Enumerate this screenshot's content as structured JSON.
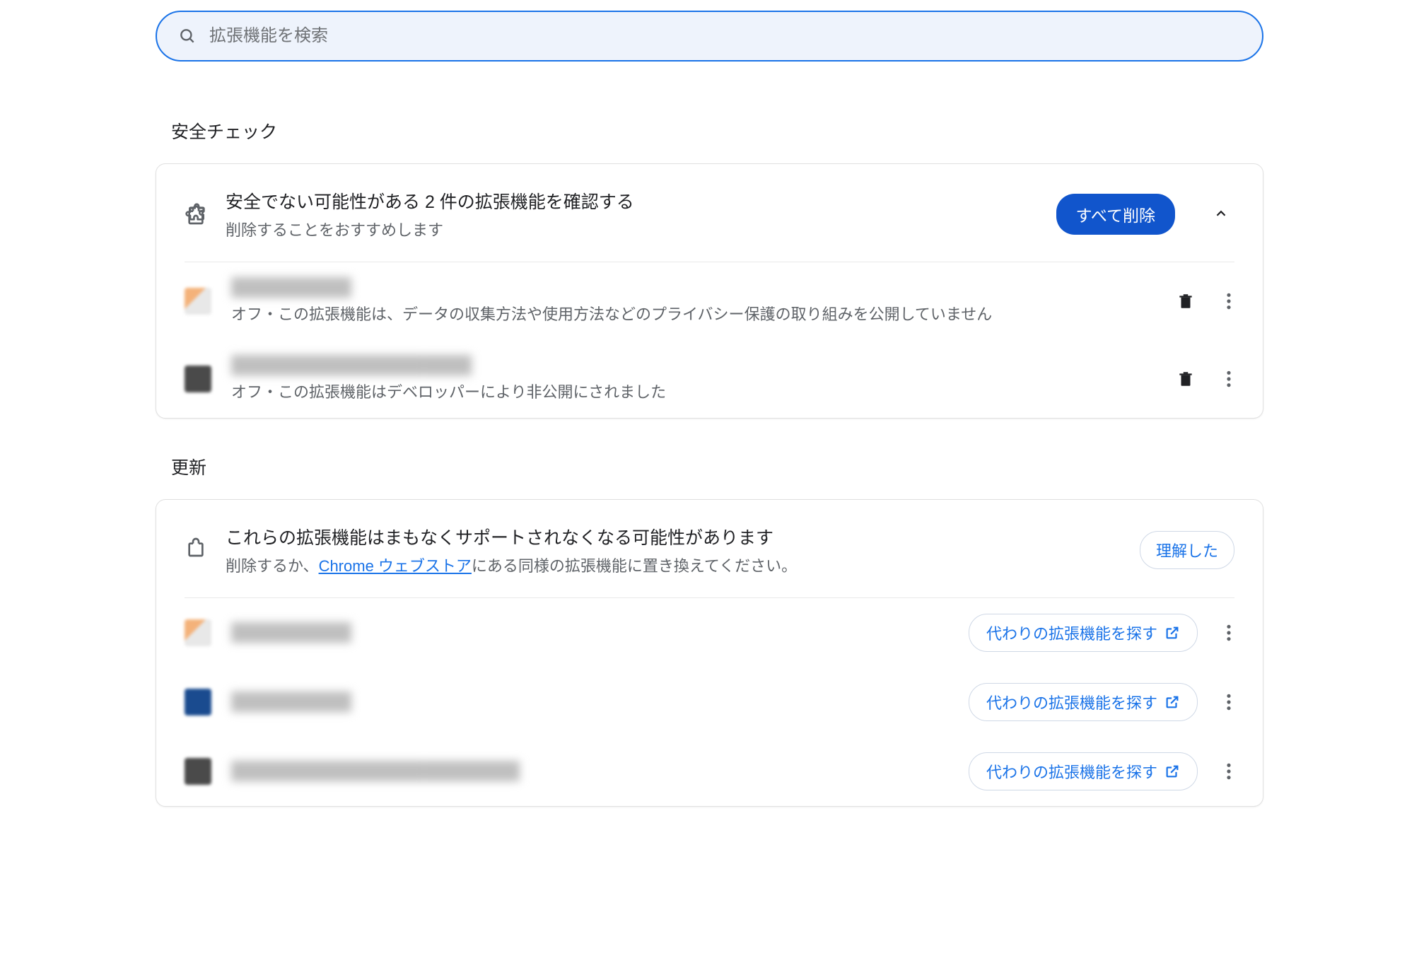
{
  "search": {
    "placeholder": "拡張機能を検索"
  },
  "safety": {
    "section_title": "安全チェック",
    "header_title": "安全でない可能性がある 2 件の拡張機能を確認する",
    "header_subtitle": "削除することをおすすめします",
    "delete_all_label": "すべて削除",
    "items": [
      {
        "name": "██████████",
        "status": "オフ・この拡張機能は、データの収集方法や使用方法などのプライバシー保護の取り組みを公開していません"
      },
      {
        "name": "████████████████████",
        "status": "オフ・この拡張機能はデベロッパーにより非公開にされました"
      }
    ]
  },
  "updates": {
    "section_title": "更新",
    "header_title": "これらの拡張機能はまもなくサポートされなくなる可能性があります",
    "header_sub_prefix": "削除するか、",
    "header_sub_link": "Chrome ウェブストア",
    "header_sub_suffix": "にある同様の拡張機能に置き換えてください。",
    "dismiss_label": "理解した",
    "find_label": "代わりの拡張機能を探す",
    "items": [
      {
        "name": "██████████"
      },
      {
        "name": "██████████"
      },
      {
        "name": "████████████████████████"
      }
    ]
  }
}
